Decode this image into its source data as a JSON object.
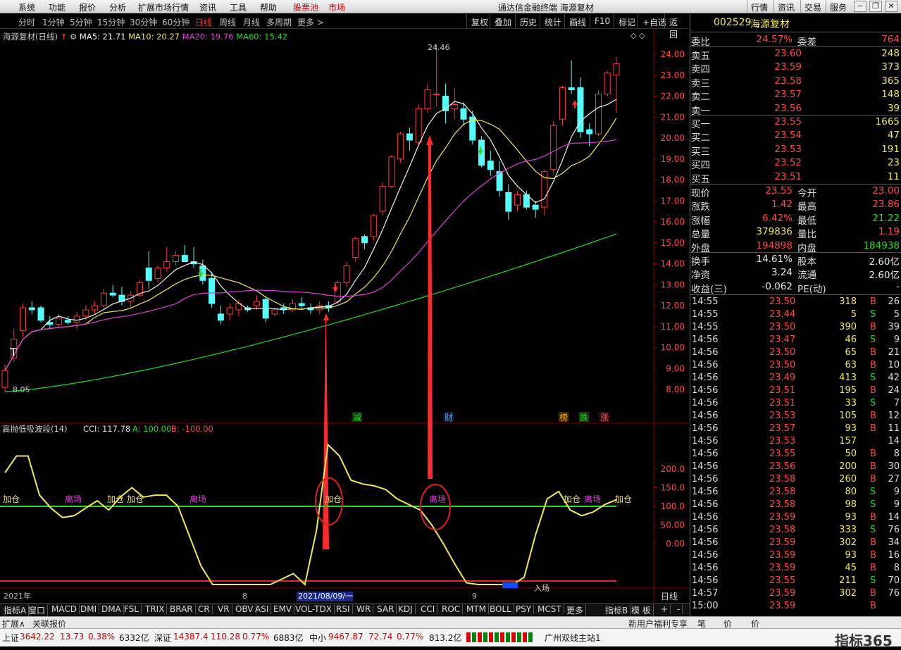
{
  "topbar": {
    "menus": [
      "系统",
      "功能",
      "报价",
      "分析",
      "扩展市场行情",
      "资讯",
      "工具",
      "帮助"
    ],
    "hl1": "股票池",
    "hl2": "市场",
    "title": "通达信金融终端  海源复材",
    "right": [
      "行情",
      "资讯",
      "交易",
      "服务"
    ]
  },
  "period": {
    "items": [
      "分时",
      "1分钟",
      "5分钟",
      "15分钟",
      "30分钟",
      "60分钟",
      "日线",
      "周线",
      "月线",
      "多周期",
      "更多 >"
    ],
    "active": "日线",
    "tools": [
      "复权",
      "叠加",
      "历史",
      "统计",
      "画线",
      "F10",
      "标记",
      "+自选",
      "返回"
    ]
  },
  "chart": {
    "name": "海源复材(日线)",
    "ma5": "MA5: 21.71",
    "ma10": "MA10: 20.27",
    "ma20": "MA20: 19.76",
    "ma60": "MA60: 15.42",
    "high_label": "24.46",
    "low_label": "8.05",
    "t_mark": "T",
    "y_ticks": [
      "24.00",
      "23.00",
      "22.00",
      "21.00",
      "20.00",
      "19.00",
      "18.00",
      "17.00",
      "16.00",
      "15.00",
      "14.00",
      "13.00",
      "12.00",
      "11.00",
      "10.00",
      "9.00",
      "8.00"
    ],
    "markers": [
      "减",
      "财",
      "榜",
      "跌",
      "涨"
    ],
    "ind_title": "高抛低吸波段(14)",
    "cci": "CCI: 117.78",
    "a": "A: 100.00",
    "b": "B: -100.00",
    "ind_ticks": [
      "200.0",
      "150.0",
      "100.0",
      "50.00",
      "0.00"
    ],
    "labels": [
      "加仓",
      "离场",
      "加仓",
      "加仓",
      "离场",
      "加仓",
      "离场",
      "加仓",
      "离场",
      "加仓",
      "入场"
    ],
    "x_labels": [
      "2021年",
      "8",
      "2021/08/09/一",
      "9"
    ],
    "period_label": "日线"
  },
  "tabs": [
    "指标A",
    "窗口",
    "MACD",
    "DMI",
    "DMA",
    "FSL",
    "TRIX",
    "BRAR",
    "CR",
    "VR",
    "OBV",
    "ASI",
    "EMV",
    "VOL-TDX",
    "RSI",
    "WR",
    "SAR",
    "KDJ",
    "CCI",
    "ROC",
    "MTM",
    "BOLL",
    "PSY",
    "MCST",
    "更多",
    "指标B",
    "模 板",
    "+",
    "-"
  ],
  "botbar": [
    "扩展∧",
    "关联报价"
  ],
  "botbar_right": [
    "新用户福利专享",
    "笔",
    "价",
    "价"
  ],
  "panel": {
    "code": "002529",
    "name": "海源复材",
    "wb": {
      "l": "委比",
      "v": "24.57%",
      "l2": "委差",
      "v2": "764"
    },
    "sell": [
      {
        "l": "卖五",
        "p": "23.60",
        "q": "248"
      },
      {
        "l": "卖四",
        "p": "23.59",
        "q": "373"
      },
      {
        "l": "卖三",
        "p": "23.58",
        "q": "365"
      },
      {
        "l": "卖二",
        "p": "23.57",
        "q": "148"
      },
      {
        "l": "卖一",
        "p": "23.56",
        "q": "39"
      }
    ],
    "buy": [
      {
        "l": "买一",
        "p": "23.55",
        "q": "1665"
      },
      {
        "l": "买二",
        "p": "23.54",
        "q": "47"
      },
      {
        "l": "买三",
        "p": "23.53",
        "q": "191"
      },
      {
        "l": "买四",
        "p": "23.52",
        "q": "23"
      },
      {
        "l": "买五",
        "p": "23.51",
        "q": "11"
      }
    ],
    "quote": [
      {
        "l": "现价",
        "v": "23.55",
        "l2": "今开",
        "v2": "23.00",
        "c": "red",
        "c2": "red"
      },
      {
        "l": "涨跌",
        "v": "1.42",
        "l2": "最高",
        "v2": "23.86",
        "c": "red",
        "c2": "red"
      },
      {
        "l": "涨幅",
        "v": "6.42%",
        "l2": "最低",
        "v2": "21.22",
        "c": "red",
        "c2": "grn"
      },
      {
        "l": "总量",
        "v": "379836",
        "l2": "量比",
        "v2": "1.19",
        "c": "yel",
        "c2": "red"
      },
      {
        "l": "外盘",
        "v": "194898",
        "l2": "内盘",
        "v2": "184938",
        "c": "red",
        "c2": "grn"
      }
    ],
    "quote2": [
      {
        "l": "换手",
        "v": "14.61%",
        "l2": "股本",
        "v2": "2.60亿",
        "c": "wht",
        "c2": "wht"
      },
      {
        "l": "净资",
        "v": "3.24",
        "l2": "流通",
        "v2": "2.60亿",
        "c": "wht",
        "c2": "wht"
      },
      {
        "l": "收益(三)",
        "v": "-0.062",
        "l2": "PE(动)",
        "v2": "-",
        "c": "wht",
        "c2": "wht"
      }
    ],
    "ticks": [
      [
        "14:55",
        "23.50",
        "318",
        "B",
        "26"
      ],
      [
        "14:55",
        "23.44",
        "5",
        "S",
        "5"
      ],
      [
        "14:55",
        "23.50",
        "390",
        "B",
        "39"
      ],
      [
        "14:56",
        "23.47",
        "46",
        "S",
        "9"
      ],
      [
        "14:56",
        "23.50",
        "65",
        "B",
        "21"
      ],
      [
        "14:56",
        "23.50",
        "63",
        "B",
        "10"
      ],
      [
        "14:56",
        "23.49",
        "413",
        "S",
        "42"
      ],
      [
        "14:56",
        "23.51",
        "195",
        "B",
        "24"
      ],
      [
        "14:56",
        "23.51",
        "33",
        "S",
        "7"
      ],
      [
        "14:56",
        "23.53",
        "105",
        "B",
        "12"
      ],
      [
        "14:56",
        "23.57",
        "93",
        "B",
        "11"
      ],
      [
        "14:56",
        "23.53",
        "157",
        "",
        "14"
      ],
      [
        "14:56",
        "23.55",
        "50",
        "B",
        "8"
      ],
      [
        "14:56",
        "23.56",
        "200",
        "B",
        "30"
      ],
      [
        "14:56",
        "23.58",
        "260",
        "B",
        "27"
      ],
      [
        "14:56",
        "23.58",
        "80",
        "S",
        "9"
      ],
      [
        "14:56",
        "23.58",
        "98",
        "S",
        "9"
      ],
      [
        "14:56",
        "23.59",
        "93",
        "B",
        "14"
      ],
      [
        "14:56",
        "23.58",
        "333",
        "S",
        "76"
      ],
      [
        "14:56",
        "23.59",
        "302",
        "B",
        "34"
      ],
      [
        "14:56",
        "23.59",
        "93",
        "B",
        "16"
      ],
      [
        "14:56",
        "23.59",
        "45",
        "B",
        "8"
      ],
      [
        "14:56",
        "23.55",
        "211",
        "S",
        "70"
      ],
      [
        "14:57",
        "23.59",
        "302",
        "B",
        "76"
      ],
      [
        "15:00",
        "23.59",
        "",
        "B",
        ""
      ]
    ]
  },
  "status": {
    "sh": "上证",
    "sh_v": "3642.22",
    "sh_c": "13.73",
    "sh_p": "0.38%",
    "sh_a": "6332亿",
    "sz": "深证",
    "sz_v": "14387.4",
    "sz_c": "110.28",
    "sz_p": "0.77%",
    "sz_a": "6883亿",
    "zx": "中小",
    "zx_v": "9467.87",
    "zx_c": "72.74",
    "zx_p": "0.77%",
    "zx_a": "813.2亿",
    "site": "广州双线主站1",
    "brand": "指标365"
  },
  "chart_data": {
    "type": "candlestick",
    "title": "海源复材(日线)",
    "ylim": [
      7.5,
      24.5
    ],
    "ohlc": [
      [
        8.1,
        9.2,
        7.9,
        8.9
      ],
      [
        9.5,
        10.9,
        9.3,
        10.4
      ],
      [
        10.8,
        12.1,
        10.5,
        11.9
      ],
      [
        11.9,
        12.2,
        11.6,
        11.8
      ],
      [
        11.9,
        12.0,
        11.2,
        11.3
      ],
      [
        11.2,
        11.5,
        10.9,
        11.1
      ],
      [
        11.1,
        11.6,
        10.9,
        11.4
      ],
      [
        11.3,
        11.5,
        11.1,
        11.2
      ],
      [
        11.2,
        11.7,
        10.9,
        11.5
      ],
      [
        11.5,
        12.0,
        11.3,
        11.8
      ],
      [
        11.8,
        12.2,
        11.6,
        12.0
      ],
      [
        12.0,
        12.8,
        11.9,
        12.6
      ],
      [
        12.6,
        13.0,
        12.4,
        12.5
      ],
      [
        12.5,
        12.9,
        12.0,
        12.2
      ],
      [
        12.2,
        12.7,
        11.9,
        12.5
      ],
      [
        12.5,
        13.2,
        12.4,
        13.1
      ],
      [
        13.8,
        14.6,
        12.8,
        13.2
      ],
      [
        13.3,
        13.9,
        13.1,
        13.8
      ],
      [
        13.8,
        14.8,
        13.6,
        14.1
      ],
      [
        14.1,
        14.6,
        13.9,
        14.4
      ],
      [
        14.4,
        14.9,
        14.2,
        14.1
      ],
      [
        14.1,
        14.8,
        13.8,
        14.0
      ],
      [
        13.9,
        14.2,
        13.0,
        13.2
      ],
      [
        13.3,
        13.6,
        11.9,
        12.1
      ],
      [
        11.6,
        12.0,
        11.1,
        11.3
      ],
      [
        11.6,
        12.1,
        11.3,
        11.9
      ],
      [
        11.8,
        12.3,
        11.5,
        12.1
      ],
      [
        11.9,
        12.0,
        11.7,
        11.8
      ],
      [
        12.0,
        12.5,
        11.8,
        12.2
      ],
      [
        12.3,
        12.4,
        11.2,
        11.4
      ],
      [
        11.6,
        11.9,
        11.5,
        11.8
      ],
      [
        11.9,
        12.1,
        11.6,
        11.8
      ],
      [
        11.8,
        12.3,
        11.7,
        12.1
      ],
      [
        12.1,
        12.4,
        11.9,
        12.0
      ],
      [
        11.9,
        12.1,
        11.6,
        11.8
      ],
      [
        11.8,
        12.2,
        11.6,
        12.0
      ],
      [
        12.0,
        12.2,
        11.7,
        11.9
      ],
      [
        12.2,
        13.2,
        12.1,
        13.1
      ],
      [
        13.1,
        14.1,
        12.9,
        13.9
      ],
      [
        14.3,
        15.3,
        14.1,
        15.2
      ],
      [
        15.3,
        15.4,
        14.7,
        15.0
      ],
      [
        15.3,
        16.4,
        15.1,
        16.3
      ],
      [
        16.5,
        17.9,
        16.3,
        17.7
      ],
      [
        17.7,
        19.2,
        17.6,
        19.1
      ],
      [
        19.0,
        20.3,
        18.8,
        20.2
      ],
      [
        20.2,
        20.5,
        19.4,
        19.9
      ],
      [
        19.8,
        21.6,
        19.7,
        21.4
      ],
      [
        21.4,
        22.6,
        21.2,
        22.3
      ],
      [
        22.1,
        24.46,
        21.5,
        22.1
      ],
      [
        22.0,
        22.6,
        20.7,
        21.3
      ],
      [
        21.4,
        22.4,
        20.9,
        21.6
      ],
      [
        21.4,
        21.7,
        20.6,
        20.9
      ],
      [
        21.0,
        21.3,
        19.7,
        19.9
      ],
      [
        19.9,
        20.1,
        18.6,
        18.7
      ],
      [
        18.9,
        19.4,
        18.2,
        18.5
      ],
      [
        18.4,
        18.9,
        17.2,
        17.5
      ],
      [
        17.4,
        17.8,
        16.1,
        16.5
      ],
      [
        16.8,
        17.5,
        16.5,
        17.3
      ],
      [
        17.3,
        17.5,
        16.6,
        16.7
      ],
      [
        16.8,
        17.0,
        16.2,
        16.6
      ],
      [
        16.7,
        18.5,
        16.3,
        18.4
      ],
      [
        18.5,
        20.8,
        18.3,
        20.6
      ],
      [
        20.9,
        22.5,
        20.6,
        22.4
      ],
      [
        22.4,
        23.7,
        22.1,
        22.3
      ],
      [
        22.4,
        22.9,
        20.0,
        20.3
      ],
      [
        20.4,
        20.7,
        19.6,
        20.2
      ],
      [
        20.2,
        22.3,
        20.1,
        22.1
      ],
      [
        22.1,
        23.2,
        22.0,
        23.1
      ],
      [
        23.0,
        23.86,
        21.22,
        23.55
      ]
    ],
    "ma5_last": 21.71,
    "ma10_last": 20.27,
    "ma20_last": 19.76,
    "ma60_last": 15.42,
    "cci": [
      190,
      235,
      235,
      130,
      95,
      70,
      75,
      95,
      115,
      90,
      125,
      150,
      125,
      130,
      130,
      100,
      20,
      -60,
      -135,
      -115,
      -120,
      -130,
      -145,
      -110,
      -95,
      -80,
      -110,
      35,
      265,
      235,
      170,
      160,
      155,
      145,
      120,
      105,
      90,
      50,
      0,
      -55,
      -105,
      -150,
      -155,
      -150,
      -135,
      -90,
      25,
      120,
      140,
      90,
      75,
      85,
      105,
      117.78
    ]
  }
}
